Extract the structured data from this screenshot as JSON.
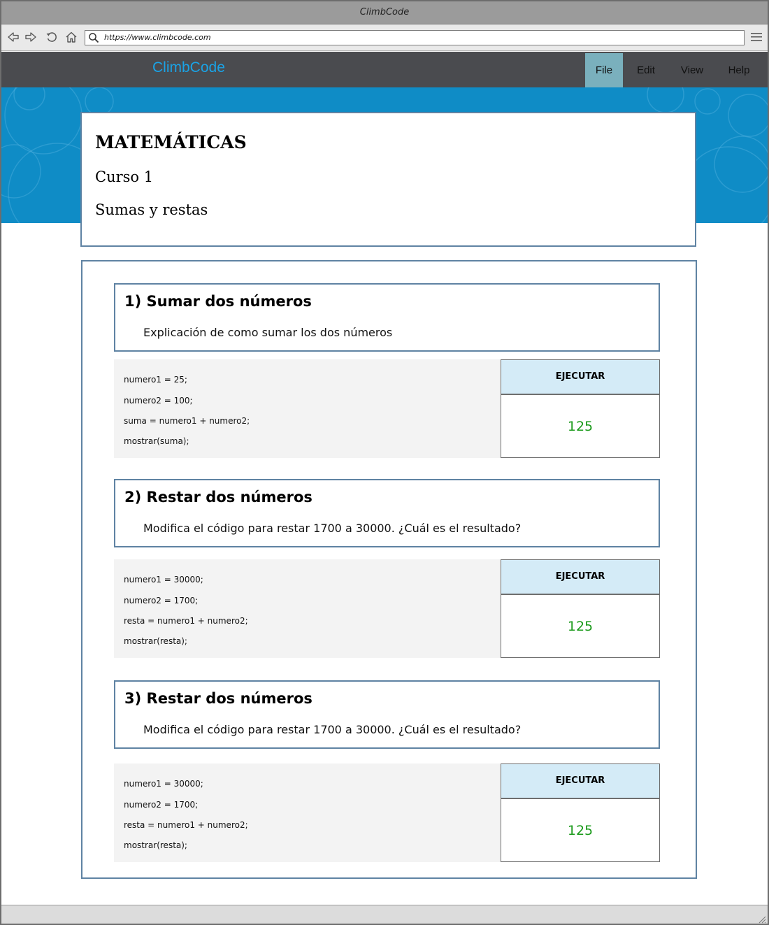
{
  "window": {
    "title": "ClimbCode"
  },
  "browser": {
    "url": "https://www.climbcode.com",
    "icons": [
      "back-icon",
      "forward-icon",
      "reload-icon",
      "home-icon",
      "search-icon",
      "hamburger-menu-icon"
    ]
  },
  "app": {
    "brand": "ClimbCode",
    "menu": [
      {
        "label": "File",
        "active": true
      },
      {
        "label": "Edit",
        "active": false
      },
      {
        "label": "View",
        "active": false
      },
      {
        "label": "Help",
        "active": false
      }
    ]
  },
  "colors": {
    "hero_blue": "#0f8cc6",
    "appbar": "#4a4b4f",
    "brand": "#1aa3e6",
    "active_menu": "#7ab0bd",
    "card_border": "#5f83a3",
    "run_button": "#d4ebf7",
    "result_green": "#1a9a1a"
  },
  "course": {
    "subject": "MATEMÁTICAS",
    "course": "Curso 1",
    "topic": "Sumas y restas"
  },
  "exercises": [
    {
      "title": "1) Sumar dos números",
      "description": "Explicación de como sumar los dos números",
      "code": [
        "numero1 = 25;",
        "numero2 = 100;",
        "suma = numero1 + numero2;",
        "mostrar(suma);"
      ],
      "run_label": "EJECUTAR",
      "result": "125"
    },
    {
      "title": "2) Restar dos números",
      "description": "Modifica el código para restar 1700 a 30000. ¿Cuál es el resultado?",
      "code": [
        "numero1 = 30000;",
        "numero2 = 1700;",
        "resta = numero1 + numero2;",
        "mostrar(resta);"
      ],
      "run_label": "EJECUTAR",
      "result": "125"
    },
    {
      "title": "3) Restar dos números",
      "description": "Modifica el código para restar 1700 a 30000. ¿Cuál es el resultado?",
      "code": [
        "numero1 = 30000;",
        "numero2 = 1700;",
        "resta = numero1 + numero2;",
        "mostrar(resta);"
      ],
      "run_label": "EJECUTAR",
      "result": "125"
    }
  ]
}
